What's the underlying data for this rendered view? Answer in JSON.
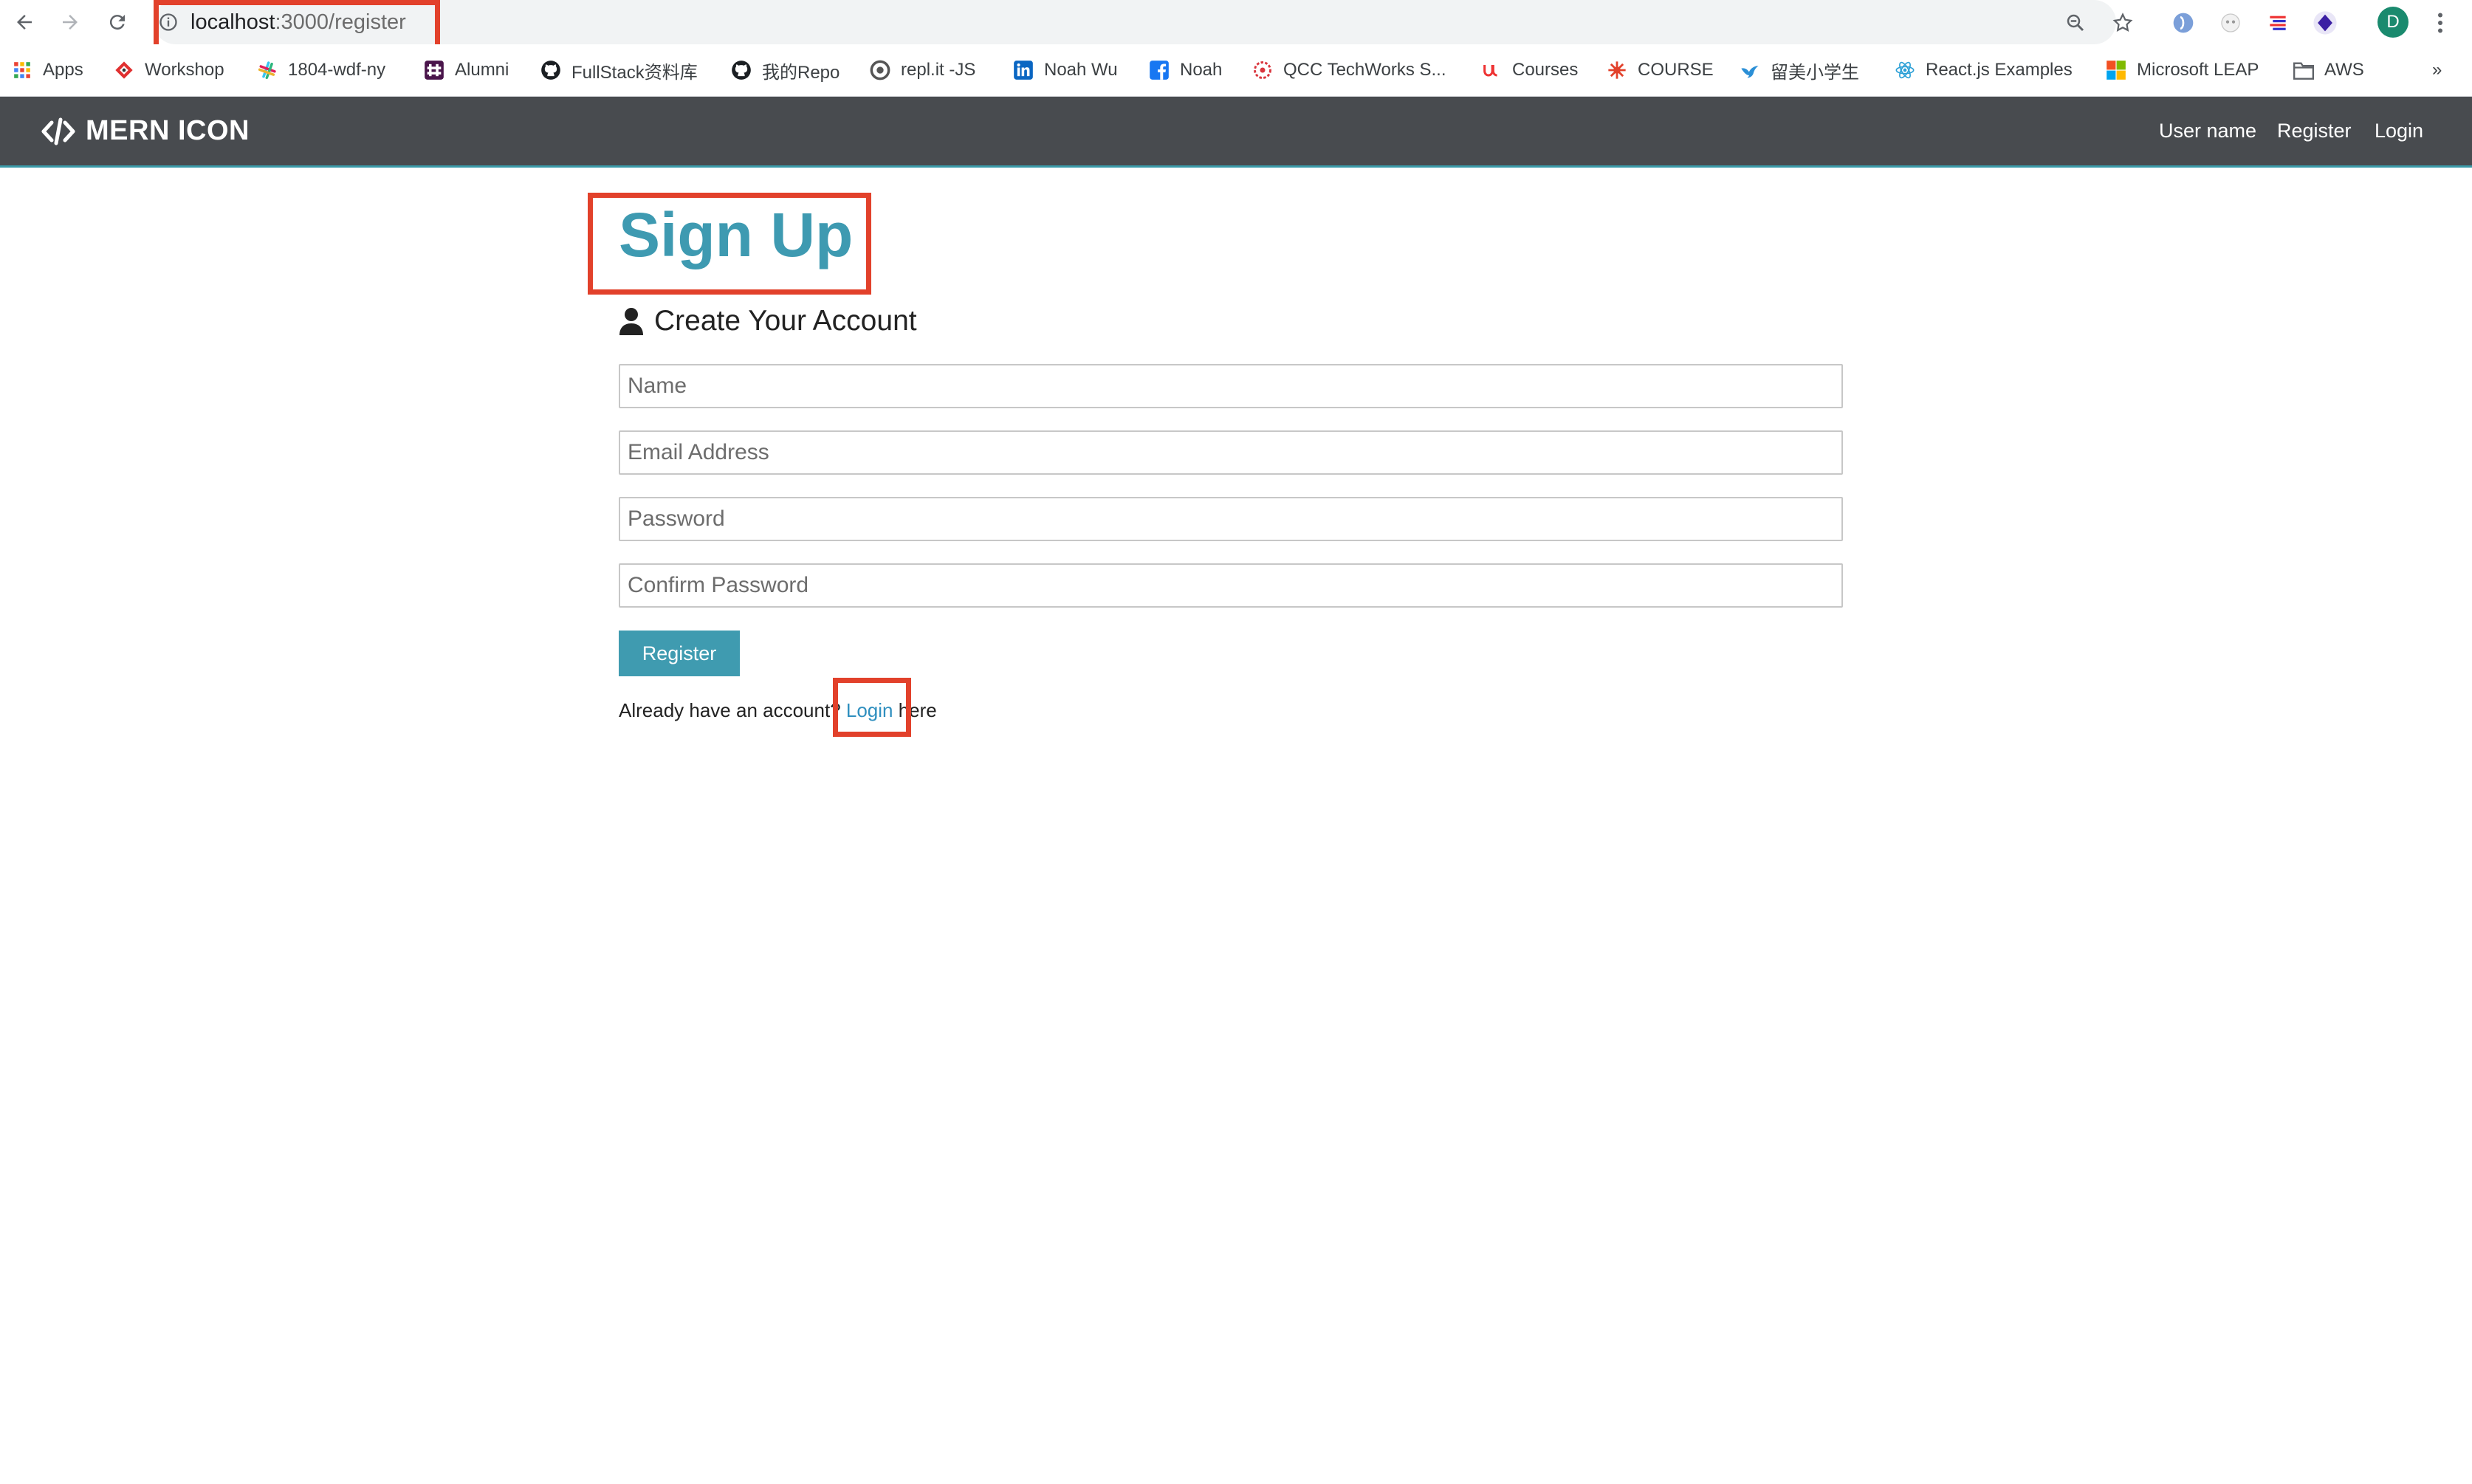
{
  "browser": {
    "url_host": "localhost",
    "url_path": ":3000/register",
    "profile_initial": "D"
  },
  "bookmarks": [
    {
      "label": "Apps",
      "icon": "apps-grid-icon"
    },
    {
      "label": "Workshop",
      "icon": "workshop-icon"
    },
    {
      "label": "1804-wdf-ny",
      "icon": "slack-icon"
    },
    {
      "label": "Alumni",
      "icon": "slack-icon"
    },
    {
      "label": "FullStack资料库",
      "icon": "github-icon"
    },
    {
      "label": "我的Repo",
      "icon": "github-icon"
    },
    {
      "label": "repl.it -JS",
      "icon": "replit-icon"
    },
    {
      "label": "Noah Wu",
      "icon": "linkedin-icon"
    },
    {
      "label": "Noah",
      "icon": "facebook-icon"
    },
    {
      "label": "QCC TechWorks S...",
      "icon": "qcc-icon"
    },
    {
      "label": "Courses",
      "icon": "udemy-icon"
    },
    {
      "label": "COURSE",
      "icon": "course-icon"
    },
    {
      "label": "留美小学生",
      "icon": "bird-icon"
    },
    {
      "label": "React.js Examples",
      "icon": "react-icon"
    },
    {
      "label": "Microsoft LEAP",
      "icon": "microsoft-icon"
    },
    {
      "label": "AWS",
      "icon": "folder-icon"
    }
  ],
  "bookmarks_overflow": "»",
  "navbar": {
    "brand": "MERN ICON",
    "links": [
      "User name",
      "Register",
      "Login"
    ]
  },
  "page": {
    "title": "Sign Up",
    "lead": "Create Your Account",
    "fields": {
      "name_placeholder": "Name",
      "email_placeholder": "Email Address",
      "password_placeholder": "Password",
      "confirm_placeholder": "Confirm Password"
    },
    "register_button": "Register",
    "already_text": "Already have an account? ",
    "login_link": "Login",
    "here_text": " here"
  },
  "colors": {
    "navbar_bg": "#484b4f",
    "accent": "#3e9ab1",
    "highlight": "#e2412b"
  }
}
